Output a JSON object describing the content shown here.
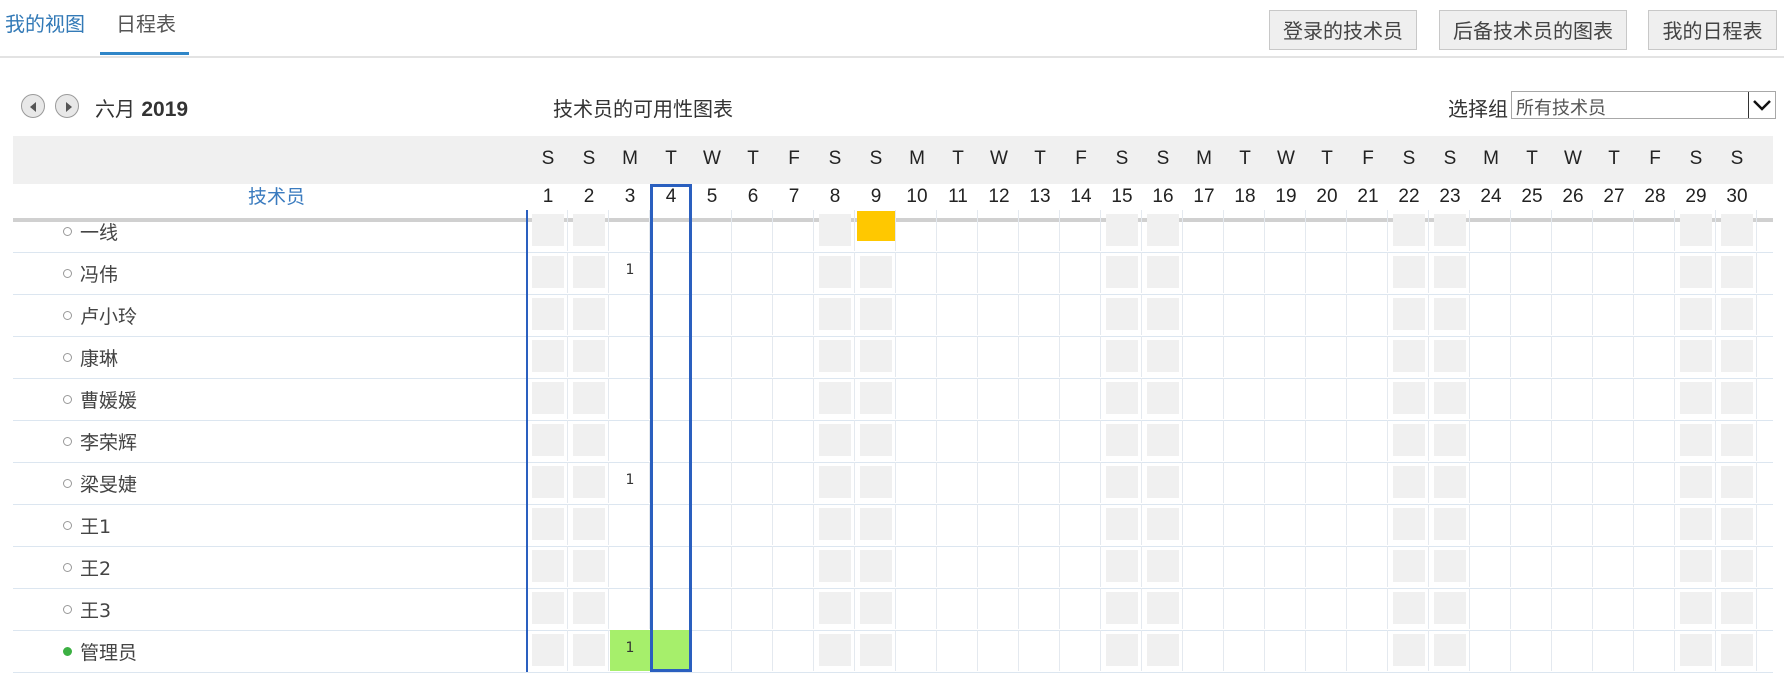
{
  "tabs": [
    {
      "label": "我的视图"
    },
    {
      "label": "日程表"
    }
  ],
  "buttons": {
    "logged_in_tech": "登录的技术员",
    "backup_tech_chart": "后备技术员的图表",
    "my_schedule": "我的日程表"
  },
  "calendar": {
    "month": "六月",
    "year": "2019",
    "title": "技术员的可用性图表",
    "group_label": "选择组",
    "group_value": "所有技术员",
    "column_header": "技术员",
    "today": 4,
    "days": [
      {
        "d": "S",
        "n": "1"
      },
      {
        "d": "S",
        "n": "2"
      },
      {
        "d": "M",
        "n": "3"
      },
      {
        "d": "T",
        "n": "4"
      },
      {
        "d": "W",
        "n": "5"
      },
      {
        "d": "T",
        "n": "6"
      },
      {
        "d": "F",
        "n": "7"
      },
      {
        "d": "S",
        "n": "8"
      },
      {
        "d": "S",
        "n": "9"
      },
      {
        "d": "M",
        "n": "10"
      },
      {
        "d": "T",
        "n": "11"
      },
      {
        "d": "W",
        "n": "12"
      },
      {
        "d": "T",
        "n": "13"
      },
      {
        "d": "F",
        "n": "14"
      },
      {
        "d": "S",
        "n": "15"
      },
      {
        "d": "S",
        "n": "16"
      },
      {
        "d": "M",
        "n": "17"
      },
      {
        "d": "T",
        "n": "18"
      },
      {
        "d": "W",
        "n": "19"
      },
      {
        "d": "T",
        "n": "20"
      },
      {
        "d": "F",
        "n": "21"
      },
      {
        "d": "S",
        "n": "22"
      },
      {
        "d": "S",
        "n": "23"
      },
      {
        "d": "M",
        "n": "24"
      },
      {
        "d": "T",
        "n": "25"
      },
      {
        "d": "W",
        "n": "26"
      },
      {
        "d": "T",
        "n": "27"
      },
      {
        "d": "F",
        "n": "28"
      },
      {
        "d": "S",
        "n": "29"
      },
      {
        "d": "S",
        "n": "30"
      }
    ],
    "technicians": [
      {
        "name": "一线",
        "active": false,
        "marks": {
          "9": {
            "color": "#ffc800"
          }
        }
      },
      {
        "name": "冯伟",
        "active": false,
        "marks": {
          "3": {
            "count": "1"
          }
        }
      },
      {
        "name": "卢小玲",
        "active": false,
        "marks": {}
      },
      {
        "name": "康琳",
        "active": false,
        "marks": {}
      },
      {
        "name": "曹媛媛",
        "active": false,
        "marks": {}
      },
      {
        "name": "李荣辉",
        "active": false,
        "marks": {}
      },
      {
        "name": "梁旻婕",
        "active": false,
        "marks": {
          "3": {
            "count": "1"
          }
        }
      },
      {
        "name": "王1",
        "active": false,
        "marks": {}
      },
      {
        "name": "王2",
        "active": false,
        "marks": {}
      },
      {
        "name": "王3",
        "active": false,
        "marks": {}
      },
      {
        "name": "管理员",
        "active": true,
        "marks": {
          "3": {
            "count": "1",
            "color": "#a6ef6b"
          },
          "4": {
            "color": "#a6ef6b"
          }
        }
      }
    ]
  },
  "colors": {
    "accent": "#2f86c8",
    "today_border": "#2a5fbf",
    "busy": "#ffc800",
    "available": "#a6ef6b"
  }
}
